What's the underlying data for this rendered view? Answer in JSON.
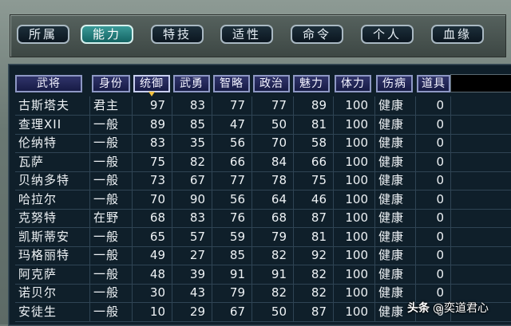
{
  "tabs": [
    {
      "label": "所属",
      "active": false
    },
    {
      "label": "能力",
      "active": true
    },
    {
      "label": "特技",
      "active": false
    },
    {
      "label": "适性",
      "active": false
    },
    {
      "label": "命令",
      "active": false
    },
    {
      "label": "个人",
      "active": false
    },
    {
      "label": "血缘",
      "active": false
    }
  ],
  "columns": [
    "武将",
    "身份",
    "统御",
    "武勇",
    "智略",
    "政治",
    "魅力",
    "体力",
    "伤病",
    "道具"
  ],
  "sorted_column": "统御",
  "rows": [
    [
      "古斯塔夫",
      "君主",
      "97",
      "83",
      "77",
      "77",
      "89",
      "100",
      "健康",
      "0"
    ],
    [
      "查理XII",
      "一般",
      "89",
      "85",
      "47",
      "50",
      "81",
      "100",
      "健康",
      "0"
    ],
    [
      "伦纳特",
      "一般",
      "83",
      "35",
      "56",
      "70",
      "58",
      "100",
      "健康",
      "0"
    ],
    [
      "瓦萨",
      "一般",
      "75",
      "82",
      "66",
      "84",
      "66",
      "100",
      "健康",
      "0"
    ],
    [
      "贝纳多特",
      "一般",
      "73",
      "67",
      "77",
      "78",
      "75",
      "100",
      "健康",
      "0"
    ],
    [
      "哈拉尔",
      "一般",
      "70",
      "90",
      "56",
      "64",
      "46",
      "100",
      "健康",
      "0"
    ],
    [
      "克努特",
      "在野",
      "68",
      "83",
      "76",
      "68",
      "87",
      "100",
      "健康",
      "0"
    ],
    [
      "凯斯蒂安",
      "一般",
      "65",
      "57",
      "59",
      "79",
      "81",
      "100",
      "健康",
      "0"
    ],
    [
      "玛格丽特",
      "一般",
      "49",
      "27",
      "85",
      "82",
      "92",
      "100",
      "健康",
      "0"
    ],
    [
      "阿克萨",
      "一般",
      "48",
      "39",
      "91",
      "91",
      "82",
      "100",
      "健康",
      "0"
    ],
    [
      "诺贝尔",
      "一般",
      "30",
      "43",
      "79",
      "82",
      "82",
      "100",
      "健康",
      "0"
    ],
    [
      "安徒生",
      "一般",
      "10",
      "29",
      "67",
      "50",
      "87",
      "100",
      "健康",
      "0"
    ]
  ],
  "watermark": {
    "logo": "头条",
    "text": "@奕道君心"
  }
}
